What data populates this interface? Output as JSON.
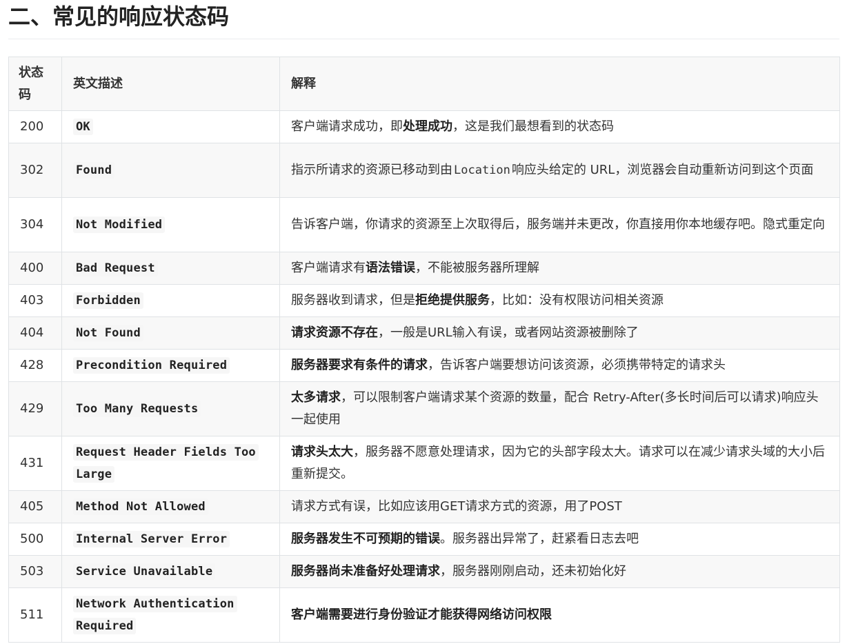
{
  "heading": "二、常见的响应状态码",
  "table": {
    "headers": [
      "状态码",
      "英文描述",
      "解释"
    ],
    "rows": [
      {
        "code": "200",
        "name": "OK",
        "desc": [
          {
            "t": "客户端请求成功，即"
          },
          {
            "t": "处理成功",
            "b": true
          },
          {
            "t": "，这是我们最想看到的状态码"
          }
        ]
      },
      {
        "code": "302",
        "name": "Found",
        "desc": [
          {
            "t": "指示所请求的资源已移动到由"
          },
          {
            "t": "Location",
            "c": true
          },
          {
            "t": "响应头给定的 URL，浏览器会自动重新访问到这个页面"
          }
        ]
      },
      {
        "code": "304",
        "name": "Not Modified",
        "desc": [
          {
            "t": "告诉客户端，你请求的资源至上次取得后，服务端并未更改，你直接用你本地缓存吧。隐式重定向"
          }
        ]
      },
      {
        "code": "400",
        "name": "Bad Request",
        "desc": [
          {
            "t": "客户端请求有"
          },
          {
            "t": "语法错误",
            "b": true
          },
          {
            "t": "，不能被服务器所理解"
          }
        ]
      },
      {
        "code": "403",
        "name": "Forbidden",
        "desc": [
          {
            "t": "服务器收到请求，但是"
          },
          {
            "t": "拒绝提供服务",
            "b": true
          },
          {
            "t": "，比如：没有权限访问相关资源"
          }
        ]
      },
      {
        "code": "404",
        "name": "Not Found",
        "desc": [
          {
            "t": "请求资源不存在",
            "b": true
          },
          {
            "t": "，一般是URL输入有误，或者网站资源被删除了"
          }
        ]
      },
      {
        "code": "428",
        "name": "Precondition Required",
        "desc": [
          {
            "t": "服务器要求有条件的请求",
            "b": true
          },
          {
            "t": "，告诉客户端要想访问该资源，必须携带特定的请求头"
          }
        ]
      },
      {
        "code": "429",
        "name": "Too Many Requests",
        "desc": [
          {
            "t": "太多请求",
            "b": true
          },
          {
            "t": "，可以限制客户端请求某个资源的数量，配合 Retry-After(多长时间后可以请求)响应头一起使用"
          }
        ]
      },
      {
        "code": "431",
        "name": "Request Header Fields Too Large",
        "desc": [
          {
            "t": "请求头太大",
            "b": true
          },
          {
            "t": "，服务器不愿意处理请求，因为它的头部字段太大。请求可以在减少请求头域的大小后重新提交。"
          }
        ]
      },
      {
        "code": "405",
        "name": "Method Not Allowed",
        "desc": [
          {
            "t": "请求方式有误，比如应该用GET请求方式的资源，用了POST"
          }
        ]
      },
      {
        "code": "500",
        "name": "Internal Server Error",
        "desc": [
          {
            "t": "服务器发生不可预期的错误",
            "b": true
          },
          {
            "t": "。服务器出异常了，赶紧看日志去吧"
          }
        ]
      },
      {
        "code": "503",
        "name": "Service Unavailable",
        "desc": [
          {
            "t": "服务器尚未准备好处理请求",
            "b": true
          },
          {
            "t": "，服务器刚刚启动，还未初始化好"
          }
        ]
      },
      {
        "code": "511",
        "name": "Network Authentication Required",
        "desc": [
          {
            "t": "客户端需要进行身份验证才能获得网络访问权限",
            "b": true
          }
        ]
      }
    ]
  }
}
